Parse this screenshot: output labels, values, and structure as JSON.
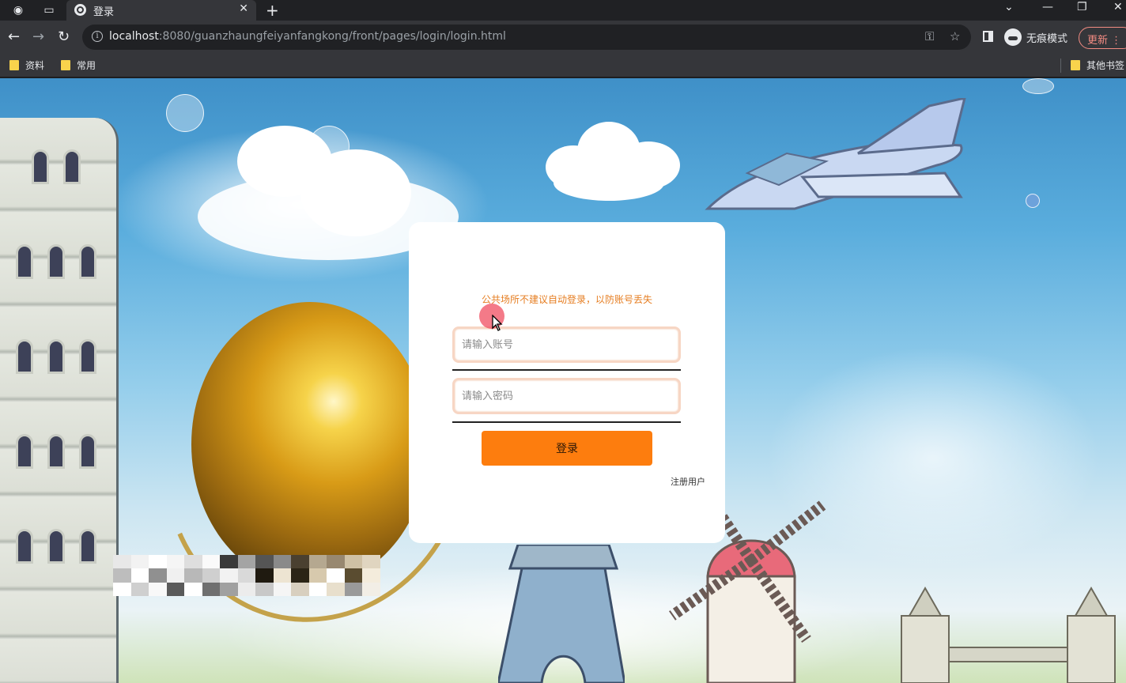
{
  "browser": {
    "tab_title": "登录",
    "url_host": "localhost",
    "url_rest": ":8080/guanzhaungfeiyanfangkong/front/pages/login/login.html",
    "incognito_label": "无痕模式",
    "update_label": "更新",
    "bookmarks": [
      "资料",
      "常用"
    ],
    "other_bookmarks": "其他书签"
  },
  "login": {
    "notice": "公共场所不建议自动登录，以防账号丢失",
    "account_placeholder": "请输入账号",
    "password_placeholder": "请输入密码",
    "login_button": "登录",
    "register_link": "注册用户"
  },
  "colors": {
    "primary_button": "#fd7d0e",
    "notice_text": "#e67e22",
    "input_border": "#f7d6c4"
  }
}
